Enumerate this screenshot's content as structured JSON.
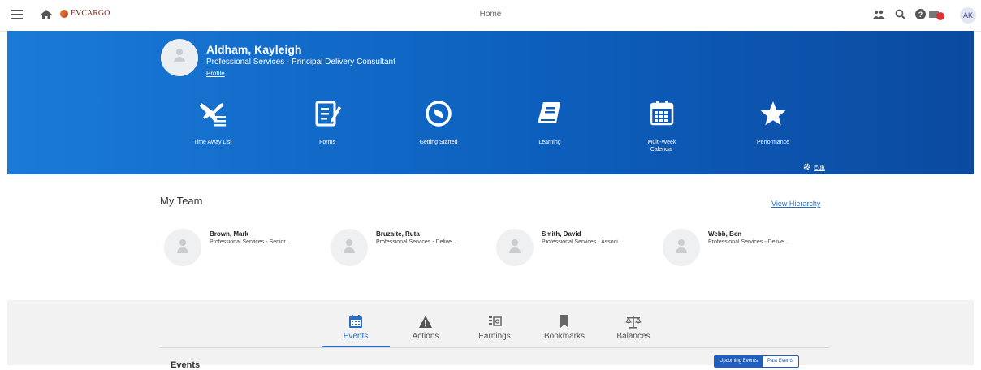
{
  "topbar": {
    "brand": "EVCARGO",
    "page_title": "Home",
    "user_initials": "AK",
    "icons": [
      "menu-icon",
      "home-icon",
      "people-icon",
      "search-icon",
      "help-icon",
      "notification-icon"
    ]
  },
  "profile": {
    "name": "Aldham, Kayleigh",
    "title": "Professional Services - Principal Delivery Consultant",
    "link": "Profile"
  },
  "tiles": [
    {
      "label": "Time Away List",
      "icon": "airplane-list-icon"
    },
    {
      "label": "Forms",
      "icon": "form-edit-icon"
    },
    {
      "label": "Getting Started",
      "icon": "compass-icon"
    },
    {
      "label": "Learning",
      "icon": "book-icon"
    },
    {
      "label": "Multi-Week Calendar",
      "icon": "calendar-icon"
    },
    {
      "label": "Performance",
      "icon": "star-icon"
    }
  ],
  "edit_label": "Edit",
  "team": {
    "title": "My Team",
    "view_hierarchy": "View Hierarchy",
    "members": [
      {
        "name": "Brown, Mark",
        "role": "Professional Services - Senior..."
      },
      {
        "name": "Bruzaite, Ruta",
        "role": "Professional Services - Delive..."
      },
      {
        "name": "Smith, David",
        "role": "Professional Services - Associ..."
      },
      {
        "name": "Webb, Ben",
        "role": "Professional Services - Delive..."
      }
    ]
  },
  "tabs": [
    {
      "label": "Events",
      "icon": "calendar-icon",
      "active": true
    },
    {
      "label": "Actions",
      "icon": "warning-icon"
    },
    {
      "label": "Earnings",
      "icon": "money-icon"
    },
    {
      "label": "Bookmarks",
      "icon": "bookmark-icon"
    },
    {
      "label": "Balances",
      "icon": "scale-icon"
    }
  ],
  "events": {
    "heading": "Events",
    "upcoming": "Upcoming Events",
    "past": "Past Events"
  },
  "colors": {
    "banner": "#0d5fbd",
    "accent": "#2a6cc0"
  }
}
